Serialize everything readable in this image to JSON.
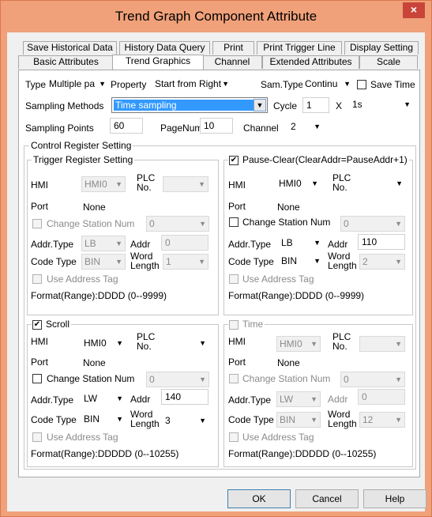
{
  "window": {
    "title": "Trend Graph Component Attribute",
    "close": "×"
  },
  "tabs_top": [
    "Save Historical Data",
    "History Data Query",
    "Print",
    "Print Trigger Line",
    "Display Setting"
  ],
  "tabs_bottom": [
    "Basic Attributes",
    "Trend Graphics",
    "Channel",
    "Extended Attributes",
    "Scale"
  ],
  "row1": {
    "type_label": "Type",
    "type_value": "Multiple pa",
    "property_label": "Property",
    "property_value": "Start from Right",
    "samtype_label": "Sam.Type",
    "samtype_value": "Continu",
    "save_time_label": "Save Time"
  },
  "row2": {
    "sampling_methods_label": "Sampling Methods",
    "sampling_methods_value": "Time sampling",
    "cycle_label": "Cycle",
    "cycle_value": "1",
    "x_label": "X",
    "cycle_unit": "1s"
  },
  "row3": {
    "sampling_points_label": "Sampling Points",
    "sampling_points_value": "60",
    "pagenum_label": "PageNum",
    "pagenum_value": "10",
    "channel_label": "Channel",
    "channel_value": "2"
  },
  "control_register": {
    "title": "Control Register Setting"
  },
  "trigger": {
    "title": "Trigger Register Setting",
    "hmi_label": "HMI",
    "hmi_value": "HMI0",
    "plc_label": "PLC\nNo.",
    "plc_value": "",
    "port_label": "Port",
    "port_value": "None",
    "change_station_label": "Change Station Num",
    "station_value": "0",
    "addr_type_label": "Addr.Type",
    "addr_type_value": "LB",
    "addr_label": "Addr",
    "addr_value": "0",
    "code_type_label": "Code Type",
    "code_type_value": "BIN",
    "word_length_label": "Word\nLength",
    "word_length_value": "1",
    "use_tag_label": "Use Address Tag",
    "format": "Format(Range):DDDD (0--9999)"
  },
  "pause": {
    "title": "Pause-Clear(ClearAddr=PauseAddr+1)",
    "hmi_label": "HMI",
    "hmi_value": "HMI0",
    "plc_label": "PLC\nNo.",
    "plc_value": "",
    "port_label": "Port",
    "port_value": "None",
    "change_station_label": "Change Station Num",
    "station_value": "0",
    "addr_type_label": "Addr.Type",
    "addr_type_value": "LB",
    "addr_label": "Addr",
    "addr_value": "110",
    "code_type_label": "Code Type",
    "code_type_value": "BIN",
    "word_length_label": "Word\nLength",
    "word_length_value": "2",
    "use_tag_label": "Use Address Tag",
    "format": "Format(Range):DDDD (0--9999)"
  },
  "scroll": {
    "title": "Scroll",
    "hmi_label": "HMI",
    "hmi_value": "HMI0",
    "plc_label": "PLC\nNo.",
    "plc_value": "",
    "port_label": "Port",
    "port_value": "None",
    "change_station_label": "Change Station Num",
    "station_value": "0",
    "addr_type_label": "Addr.Type",
    "addr_type_value": "LW",
    "addr_label": "Addr",
    "addr_value": "140",
    "code_type_label": "Code Type",
    "code_type_value": "BIN",
    "word_length_label": "Word\nLength",
    "word_length_value": "3",
    "use_tag_label": "Use Address Tag",
    "format": "Format(Range):DDDDD (0--10255)"
  },
  "time": {
    "title": "Time",
    "hmi_label": "HMI",
    "hmi_value": "HMI0",
    "plc_label": "PLC\nNo.",
    "plc_value": "",
    "port_label": "Port",
    "port_value": "None",
    "change_station_label": "Change Station Num",
    "station_value": "0",
    "addr_type_label": "Addr.Type",
    "addr_type_value": "LW",
    "addr_label": "Addr",
    "addr_value": "0",
    "code_type_label": "Code Type",
    "code_type_value": "BIN",
    "word_length_label": "Word\nLength",
    "word_length_value": "12",
    "use_tag_label": "Use Address Tag",
    "format": "Format(Range):DDDDD (0--10255)"
  },
  "buttons": {
    "ok": "OK",
    "cancel": "Cancel",
    "help": "Help"
  },
  "colors": {
    "titlebar": "#f0a17a",
    "close": "#c9453a",
    "highlight": "#3399ff"
  },
  "icons": {
    "dropdown": "chevron-down-icon",
    "check": "check-icon"
  }
}
